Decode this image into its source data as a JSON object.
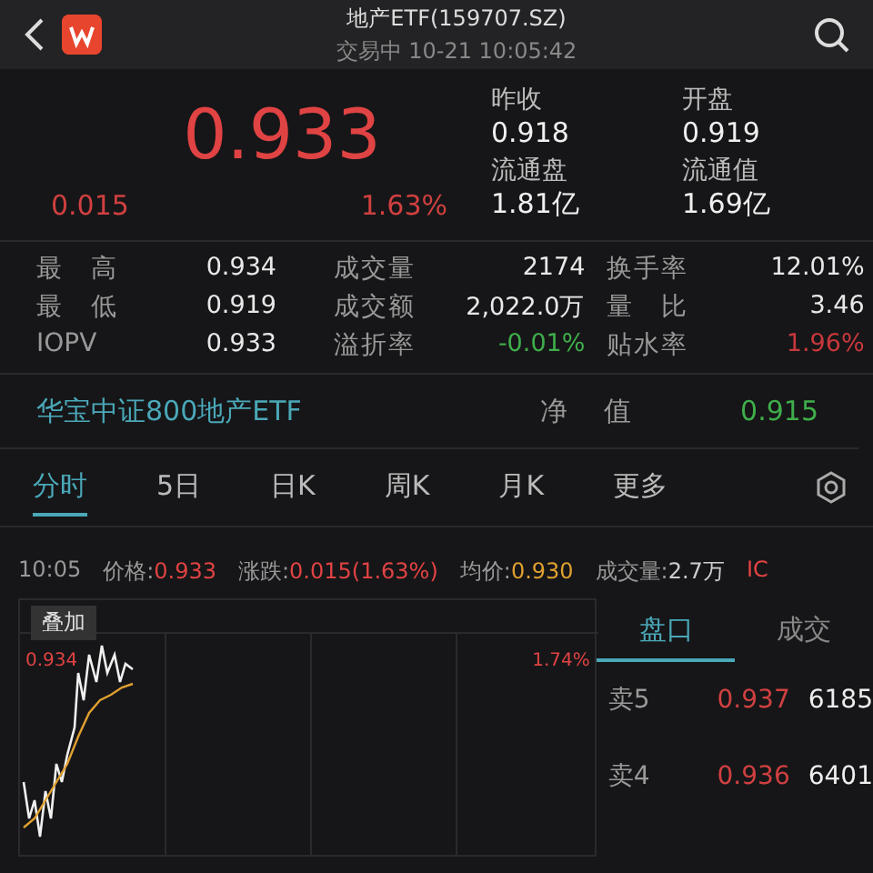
{
  "header": {
    "title": "地产ETF(159707.SZ)",
    "status": "交易中 10-21 10:05:42"
  },
  "quote": {
    "price": "0.933",
    "change": "0.015",
    "change_pct": "1.63%",
    "fields": [
      {
        "label": "昨收",
        "value": "0.918"
      },
      {
        "label": "开盘",
        "value": "0.919"
      },
      {
        "label": "流通盘",
        "value": "1.81亿"
      },
      {
        "label": "流通值",
        "value": "1.69亿"
      }
    ]
  },
  "stats": [
    [
      {
        "label": "最 高",
        "value": "0.934",
        "color": "#e8e8e8"
      },
      {
        "label": "成交量",
        "value": "2174",
        "color": "#e8e8e8"
      },
      {
        "label": "换手率",
        "value": "12.01%",
        "color": "#e8e8e8"
      }
    ],
    [
      {
        "label": "最 低",
        "value": "0.919",
        "color": "#e8e8e8"
      },
      {
        "label": "成交额",
        "value": "2,022.0万",
        "color": "#e8e8e8"
      },
      {
        "label": "量 比",
        "value": "3.46",
        "color": "#e8e8e8"
      }
    ],
    [
      {
        "label": "IOPV",
        "value": "0.933",
        "color": "#e8e8e8"
      },
      {
        "label": "溢折率",
        "value": "-0.01%",
        "color": "#3fae4a"
      },
      {
        "label": "贴水率",
        "value": "1.96%",
        "color": "#c8383c"
      }
    ]
  ],
  "fund": {
    "name": "华宝中证800地产ETF",
    "nav_label": "净 值",
    "nav_value": "0.915"
  },
  "tabs": [
    {
      "label": "分时",
      "selected": true
    },
    {
      "label": "5日",
      "selected": false
    },
    {
      "label": "日K",
      "selected": false
    },
    {
      "label": "周K",
      "selected": false
    },
    {
      "label": "月K",
      "selected": false
    },
    {
      "label": "更多",
      "selected": false
    }
  ],
  "info": {
    "time": "10:05",
    "items": [
      {
        "label": "价格:",
        "value": "0.933",
        "color": "#e04343"
      },
      {
        "label": "涨跌:",
        "value": "0.015(1.63%)",
        "color": "#e04343"
      },
      {
        "label": "均价:",
        "value": "0.930",
        "color": "#e0a030"
      },
      {
        "label": "成交量:",
        "value": "2.7万",
        "color": "#cccccc"
      }
    ],
    "tail": "IC"
  },
  "chart": {
    "overlay": "叠加",
    "high_price": "0.934",
    "high_pct": "1.74%"
  },
  "book": {
    "tabs": [
      {
        "label": "盘口",
        "selected": true
      },
      {
        "label": "成交",
        "selected": false
      }
    ],
    "rows": [
      {
        "side": "卖5",
        "price": "0.937",
        "volume": "6185"
      },
      {
        "side": "卖4",
        "price": "0.936",
        "volume": "6401"
      }
    ]
  }
}
